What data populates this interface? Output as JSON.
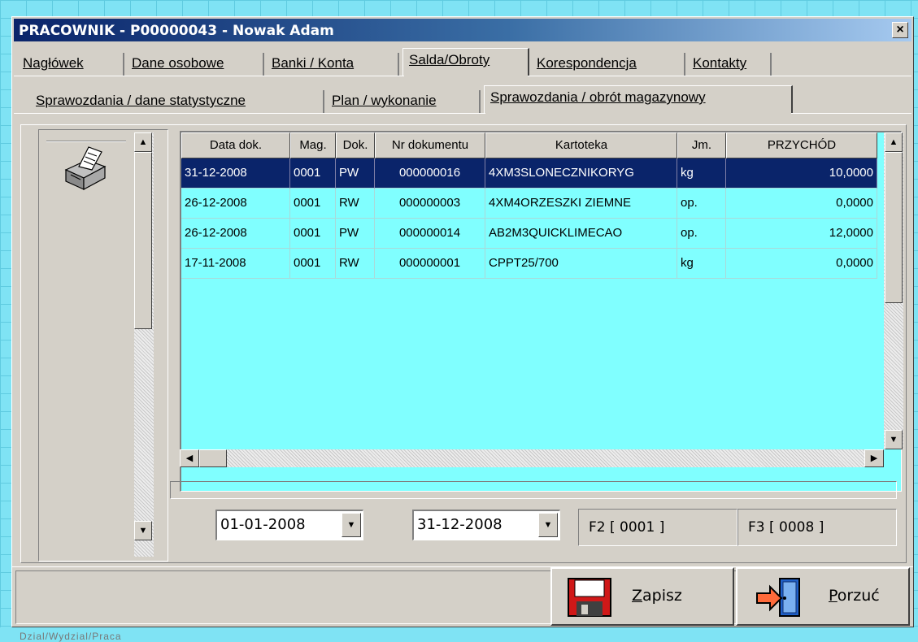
{
  "window": {
    "title": "PRACOWNIK  - P00000043 - Nowak  Adam",
    "close_label": "×"
  },
  "tabs_top": [
    {
      "label": "Nagłówek"
    },
    {
      "label": "Dane osobowe"
    },
    {
      "label": "Banki / Konta"
    },
    {
      "label": "Salda/Obroty"
    },
    {
      "label": "Korespondencja"
    },
    {
      "label": "Kontakty"
    }
  ],
  "tabs_sub": [
    {
      "label": "Sprawozdania / dane statystyczne"
    },
    {
      "label": "Plan / wykonanie"
    },
    {
      "label": "Sprawozdania / obrót magazynowy"
    }
  ],
  "grid": {
    "columns": [
      "Data dok.",
      "Mag.",
      "Dok.",
      "Nr dokumentu",
      "Kartoteka",
      "Jm.",
      "PRZYCHÓD"
    ],
    "rows": [
      [
        "31-12-2008",
        "0001",
        "PW",
        "000000016",
        "4XM3SLONECZNIKORYG",
        "kg",
        "10,0000"
      ],
      [
        "26-12-2008",
        "0001",
        "RW",
        "000000003",
        "4XM4ORZESZKI ZIEMNE",
        "op.",
        "0,0000"
      ],
      [
        "26-12-2008",
        "0001",
        "PW",
        "000000014",
        "AB2M3QUICKLIMECAO",
        "op.",
        "12,0000"
      ],
      [
        "17-11-2008",
        "0001",
        "RW",
        "000000001",
        "CPPT25/700",
        "kg",
        "0,0000"
      ]
    ]
  },
  "filters": {
    "date_from": "01-01-2008",
    "date_to": "31-12-2008",
    "f2": "F2 [ 0001 ]",
    "f3": "F3 [ 0008 ]"
  },
  "buttons": {
    "save_first": "Z",
    "save_rest": "apisz",
    "cancel_first": "P",
    "cancel_rest": "orzuć"
  },
  "background_text": "Dzial/Wydzial/Praca",
  "icons": {
    "print": "printer-icon",
    "save": "floppy-disk-icon",
    "cancel": "exit-door-icon"
  }
}
